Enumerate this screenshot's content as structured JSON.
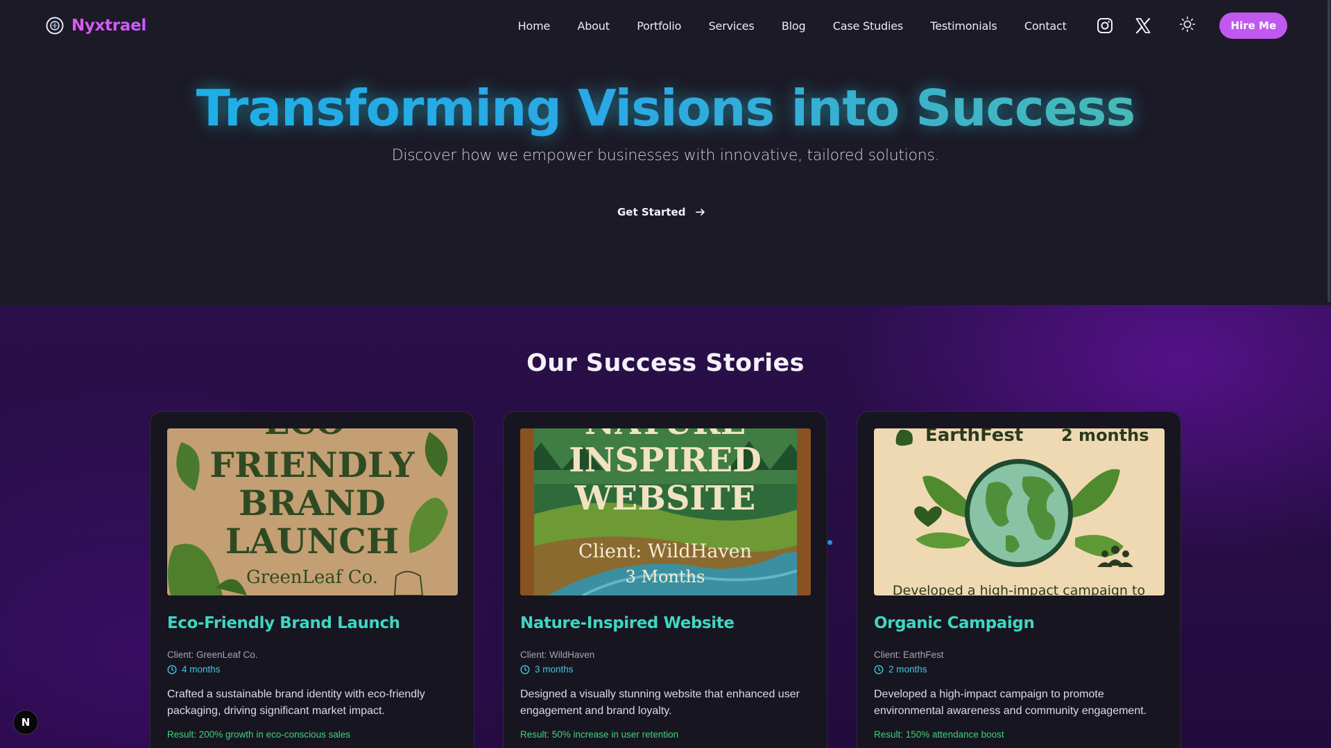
{
  "brand": {
    "name": "Nyxtrael",
    "logo_icon": "compass-logo-icon"
  },
  "nav": {
    "links": [
      "Home",
      "About",
      "Portfolio",
      "Services",
      "Blog",
      "Case Studies",
      "Testimonials",
      "Contact"
    ],
    "social_icons": [
      "instagram-icon",
      "x-icon"
    ],
    "theme_icon": "sun-icon",
    "hire_label": "Hire Me"
  },
  "hero": {
    "title": "Transforming Visions into Success",
    "subtitle": "Discover how we empower businesses with innovative, tailored solutions.",
    "cta_label": "Get Started",
    "cta_icon": "arrow-right-icon"
  },
  "stories": {
    "title": "Our Success Stories",
    "cards": [
      {
        "image_text": [
          "ECO-",
          "FRIENDLY",
          "BRAND",
          "LAUNCH",
          "GreenLeaf Co."
        ],
        "title": "Eco-Friendly Brand Launch",
        "client": "Client: GreenLeaf Co.",
        "duration": "4 months",
        "description": "Crafted a sustainable brand identity with eco-friendly packaging, driving significant market impact.",
        "result": "Result: 200% growth in eco-conscious sales"
      },
      {
        "image_text": [
          "NATURE",
          "INSPIRED",
          "WEBSITE",
          "Client: WildHaven",
          "3 Months"
        ],
        "title": "Nature-Inspired Website",
        "client": "Client: WildHaven",
        "duration": "3 months",
        "description": "Designed a visually stunning website that enhanced user engagement and brand loyalty.",
        "result": "Result: 50% increase in user retention"
      },
      {
        "image_text": [
          "EarthFest",
          "2 months",
          "Developed a high-impact campaign to"
        ],
        "title": "Organic Campaign",
        "client": "Client: EarthFest",
        "duration": "2 months",
        "description": "Developed a high-impact campaign to promote environmental awareness and community engagement.",
        "result": "Result: 150% attendance boost"
      }
    ],
    "duration_icon": "clock-icon"
  },
  "dev_badge": {
    "label": "N"
  },
  "colors": {
    "brand": "#c158f0",
    "hero_gradient": [
      "#18b2e6",
      "#52c0a5"
    ],
    "card_title": "#3fd6c3",
    "duration": "#3fc8e6",
    "result": "#3fd47a"
  }
}
